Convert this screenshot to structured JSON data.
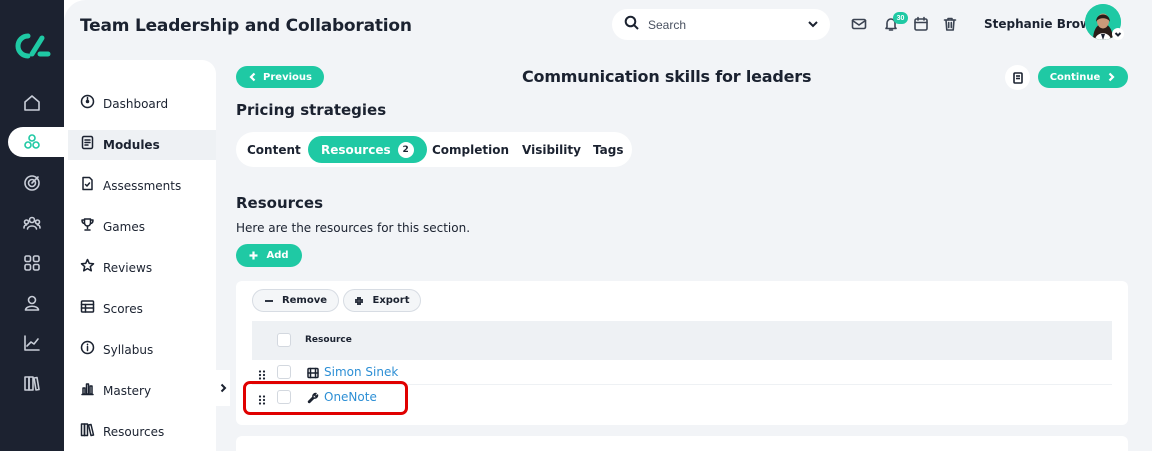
{
  "app": {
    "title": "Team Leadership and Collaboration"
  },
  "colors": {
    "accent": "#1fc9a4",
    "rail": "#1c2230",
    "link": "#2d8fd5",
    "highlight": "#e00000"
  },
  "rail": {
    "items": [
      {
        "icon": "home-icon",
        "active": false
      },
      {
        "icon": "modules-icon",
        "active": true
      },
      {
        "icon": "target-icon",
        "active": false
      },
      {
        "icon": "users-icon",
        "active": false
      },
      {
        "icon": "grid-icon",
        "active": false
      },
      {
        "icon": "person-icon",
        "active": false
      },
      {
        "icon": "chart-icon",
        "active": false
      },
      {
        "icon": "library-icon",
        "active": false
      }
    ]
  },
  "search": {
    "placeholder": "Search"
  },
  "header": {
    "notification_count": "30",
    "user_name": "Stephanie Brown"
  },
  "sidebar": {
    "items": [
      {
        "label": "Dashboard",
        "icon": "dashboard-icon"
      },
      {
        "label": "Modules",
        "icon": "modules-doc-icon",
        "active": true
      },
      {
        "label": "Assessments",
        "icon": "assessment-icon"
      },
      {
        "label": "Games",
        "icon": "trophy-icon"
      },
      {
        "label": "Reviews",
        "icon": "star-icon"
      },
      {
        "label": "Scores",
        "icon": "table-icon"
      },
      {
        "label": "Syllabus",
        "icon": "info-icon"
      },
      {
        "label": "Mastery",
        "icon": "bar-chart-icon"
      },
      {
        "label": "Resources",
        "icon": "books-icon"
      }
    ]
  },
  "nav": {
    "previous_label": "Previous",
    "continue_label": "Continue"
  },
  "page": {
    "title": "Communication skills for leaders",
    "section": "Pricing strategies"
  },
  "tabs": [
    {
      "label": "Content"
    },
    {
      "label": "Resources",
      "count": "2",
      "active": true
    },
    {
      "label": "Completion"
    },
    {
      "label": "Visibility"
    },
    {
      "label": "Tags"
    }
  ],
  "resources": {
    "heading": "Resources",
    "description": "Here are the resources for this section.",
    "add_label": "Add",
    "remove_label": "Remove",
    "export_label": "Export",
    "column_header": "Resource",
    "rows": [
      {
        "name": "Simon Sinek",
        "icon": "film-icon"
      },
      {
        "name": "OneNote",
        "icon": "wrench-icon"
      }
    ]
  }
}
